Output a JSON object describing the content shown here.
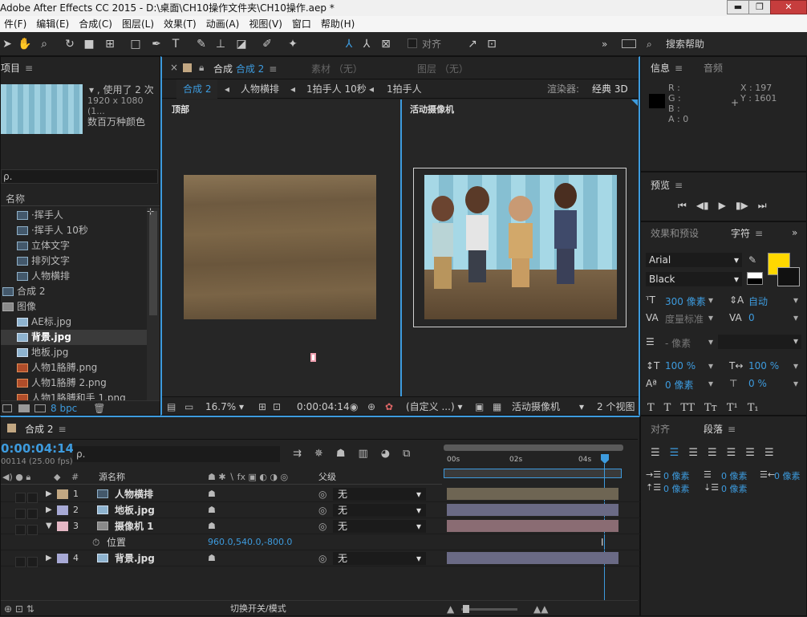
{
  "app": {
    "title": "Adobe After Effects CC 2015 - D:\\桌面\\CH10操作文件夹\\CH10操作.aep *",
    "win_min": "▬",
    "win_max": "❐",
    "win_close": "✕"
  },
  "menu": [
    "件(F)",
    "编辑(E)",
    "合成(C)",
    "图层(L)",
    "效果(T)",
    "动画(A)",
    "视图(V)",
    "窗口",
    "帮助(H)"
  ],
  "toolbar": {
    "snap_label": "对齐",
    "search_label": "搜索帮助",
    "more": "»"
  },
  "project": {
    "tab_label": "项目",
    "menu": "≡",
    "used_text": "▾ , 使用了 2 次",
    "size_text": "1920 x 1080 (1...",
    "colors_text": "数百万种颜色",
    "search_icon_text": "ρ.",
    "col_name": "名称",
    "items": [
      {
        "label": "·挥手人",
        "icon": "comp",
        "indent": 20
      },
      {
        "label": "·挥手人 10秒",
        "icon": "comp",
        "indent": 20
      },
      {
        "label": "立体文字",
        "icon": "comp",
        "indent": 20
      },
      {
        "label": "排列文字",
        "icon": "comp",
        "indent": 20
      },
      {
        "label": "人物横排",
        "icon": "comp",
        "indent": 20
      },
      {
        "label": "合成 2",
        "icon": "comp",
        "indent": 2
      },
      {
        "label": "图像",
        "icon": "fold",
        "indent": 2
      },
      {
        "label": "AE标.jpg",
        "icon": "img",
        "indent": 20
      },
      {
        "label": "背景.jpg",
        "icon": "img",
        "indent": 20,
        "selected": true
      },
      {
        "label": "地板.jpg",
        "icon": "img",
        "indent": 20
      },
      {
        "label": "人物1胳膊.png",
        "icon": "psd",
        "indent": 20
      },
      {
        "label": "人物1胳膊 2.png",
        "icon": "psd",
        "indent": 20
      },
      {
        "label": "人物1胳膊和手 1.png",
        "icon": "psd",
        "indent": 20
      }
    ],
    "bpc": "8 bpc"
  },
  "composition": {
    "tab_close": "×",
    "tab_label": "合成",
    "tab_comp_name": "合成 2",
    "footage_tab": "素材 （无）",
    "layer_tab": "图层 （无）",
    "breadcrumbs": [
      "合成 2",
      "人物横排",
      "1拍手人 10秒",
      "1拍手人"
    ],
    "renderer_label": "渲染器:",
    "renderer_value": "经典 3D",
    "view_left_label": "顶部",
    "view_right_label": "活动摄像机",
    "zoom": "16.7%",
    "timecode": "0:00:04:14",
    "resolution": "(自定义 ...)",
    "camera": "活动摄像机",
    "views": "2 个视图"
  },
  "info": {
    "tab_label": "信息",
    "audio_tab": "音频",
    "r": "R :",
    "g": "G :",
    "b": "B :",
    "a": "A : 0",
    "x": "X : 197",
    "y": "Y : 1601"
  },
  "preview": {
    "tab_label": "预览"
  },
  "effects": {
    "tab_label": "效果和预设",
    "char_tab": "字符",
    "font": "Arial",
    "style": "Black",
    "font_size": "300 像素",
    "leading": "自动",
    "kerning": "度量标准",
    "tracking": "0",
    "stroke": "- 像素",
    "vscale": "100 %",
    "hscale": "100 %",
    "baseline": "0 像素",
    "tsume": "0 %",
    "fill_color": "#ffd800"
  },
  "timeline": {
    "comp_tab": "合成 2",
    "timecode": "0:00:04:14",
    "frame_info": "00114 (25.00 fps)",
    "col_num": "#",
    "col_source": "源名称",
    "col_parent": "父级",
    "ruler": [
      "00s",
      "02s",
      "04s"
    ],
    "layers": [
      {
        "num": "1",
        "name": "人物横排",
        "icon": "comp",
        "color": "#c2a782",
        "parent": "无",
        "bar": "#6e6553"
      },
      {
        "num": "2",
        "name": "地板.jpg",
        "icon": "img",
        "color": "#a7a9d5",
        "parent": "无",
        "bar": "#6a6a85"
      },
      {
        "num": "3",
        "name": "摄像机 1",
        "icon": "cam",
        "color": "#e4b7c4",
        "parent": "无",
        "bar": "#8a6c73"
      },
      {
        "num": "4",
        "name": "背景.jpg",
        "icon": "img",
        "color": "#a7a9d5",
        "parent": "无",
        "bar": "#6a6a85"
      }
    ],
    "position_label": "位置",
    "position_value": "960.0,540.0,-800.0",
    "toggle_label": "切换开关/模式"
  },
  "align": {
    "tab_label": "对齐",
    "para_tab": "段落",
    "indent_left": "0 像素",
    "indent_first": "0 像素",
    "indent_right": "0 像素",
    "space_before": "0 像素",
    "space_after": "0 像素"
  }
}
